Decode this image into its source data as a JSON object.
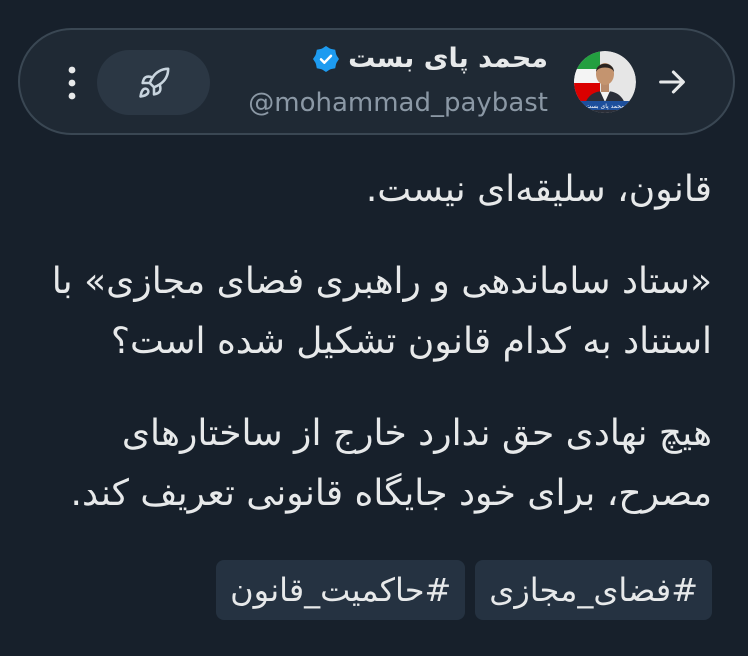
{
  "header": {
    "back_icon": "arrow-right-icon",
    "avatar": {
      "caption": "محمد پای بست"
    },
    "name": "محمد پای بست",
    "verified_icon": "verified-badge-icon",
    "handle": "@mohammad_paybast",
    "boost_icon": "rocket-icon",
    "more_icon": "more-vertical-icon"
  },
  "post": {
    "paragraphs": [
      {
        "lines": [
          "قانون، سلیقه‌ای نیست."
        ]
      },
      {
        "lines": [
          "«ستاد ساماندهی و راهبری فضای مجازی» با",
          "استناد به کدام قانون تشکیل شده است؟"
        ]
      },
      {
        "lines": [
          "هیچ نهادی حق ندارد خارج از ساختارهای",
          "مصرح، برای خود جایگاه قانونی تعریف کند."
        ]
      }
    ],
    "hashtags": [
      "#فضای_مجازی",
      "#حاکمیت_قانون"
    ]
  },
  "colors": {
    "background": "#17202b",
    "text": "#e7e9ea",
    "muted": "#8b98a5",
    "accent": "#1d9bf0",
    "chip": "#253241",
    "pill": "#1f2934",
    "pill_border": "#3a4753",
    "button": "#2b3744"
  }
}
